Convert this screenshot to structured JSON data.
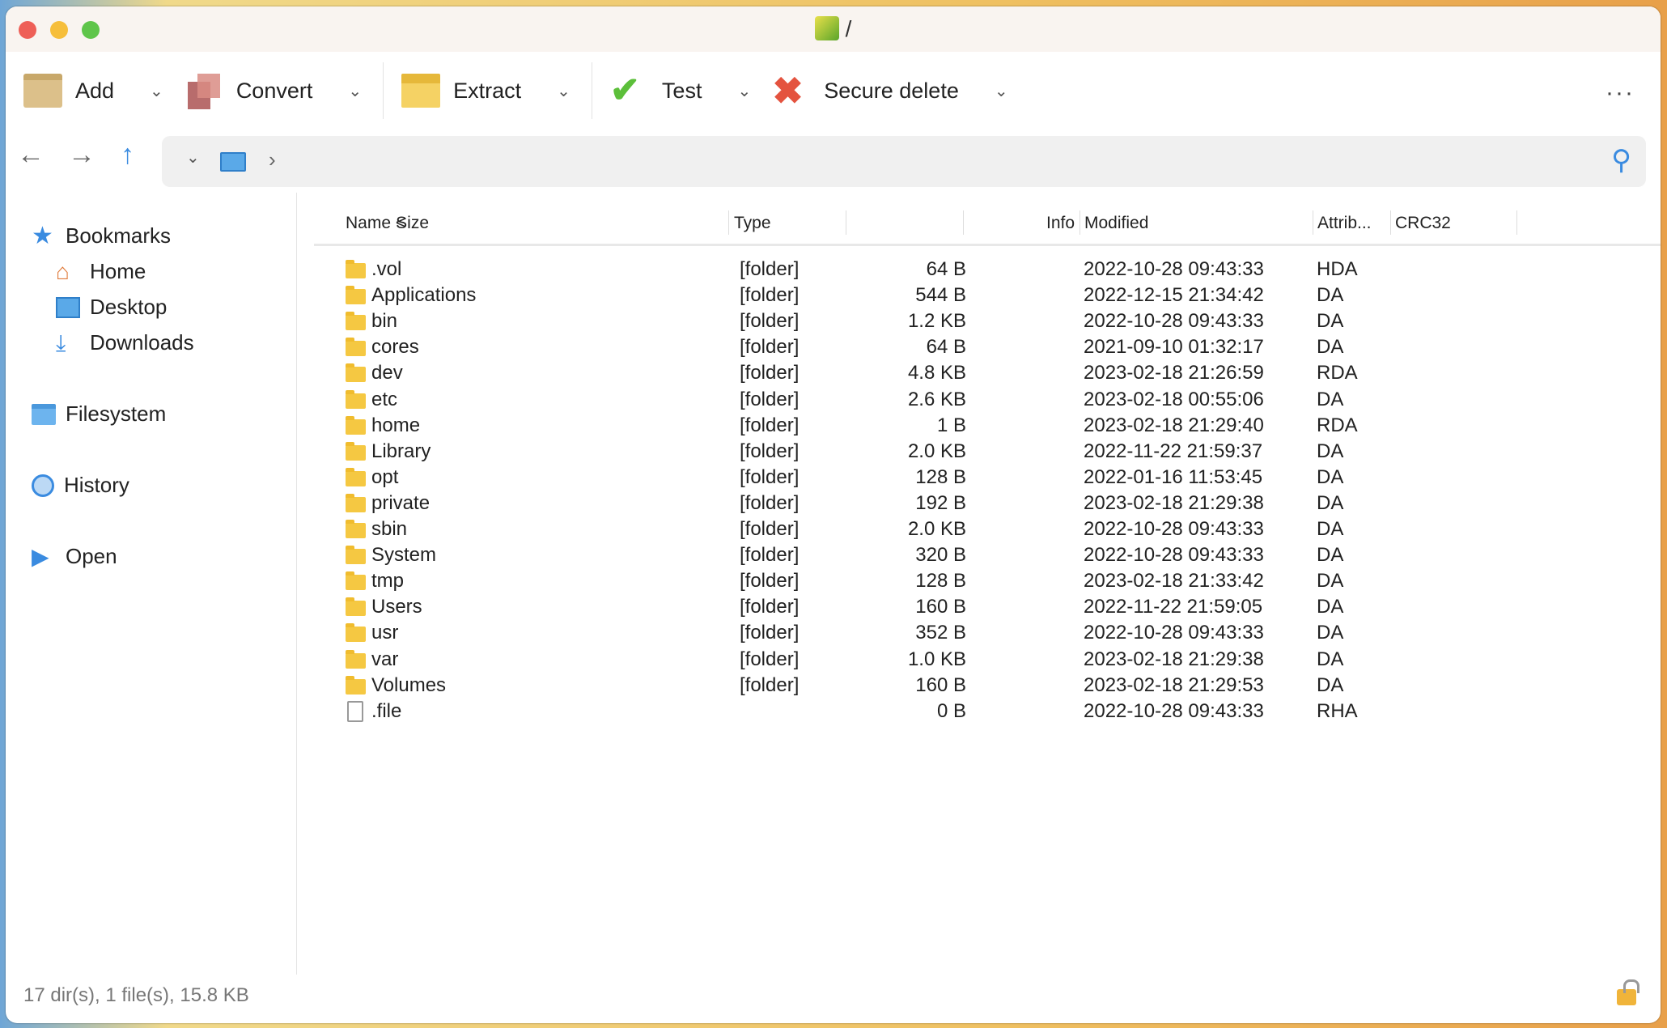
{
  "window": {
    "title": "/"
  },
  "toolbar": {
    "add": "Add",
    "convert": "Convert",
    "extract": "Extract",
    "test": "Test",
    "secure_delete": "Secure delete",
    "more": "···"
  },
  "sidebar": {
    "bookmarks": "Bookmarks",
    "home": "Home",
    "desktop": "Desktop",
    "downloads": "Downloads",
    "filesystem": "Filesystem",
    "history": "History",
    "open": "Open"
  },
  "columns": {
    "name": "Name <",
    "type": "Type",
    "size": "Size",
    "info": "Info",
    "modified": "Modified",
    "attrib": "Attrib...",
    "crc32": "CRC32"
  },
  "rows": [
    {
      "name": ".vol",
      "type": "[folder]",
      "size": "64 B",
      "modified": "2022-10-28 09:43:33",
      "attrib": "HDA",
      "kind": "folder"
    },
    {
      "name": "Applications",
      "type": "[folder]",
      "size": "544 B",
      "modified": "2022-12-15 21:34:42",
      "attrib": "DA",
      "kind": "folder"
    },
    {
      "name": "bin",
      "type": "[folder]",
      "size": "1.2 KB",
      "modified": "2022-10-28 09:43:33",
      "attrib": "DA",
      "kind": "folder"
    },
    {
      "name": "cores",
      "type": "[folder]",
      "size": "64 B",
      "modified": "2021-09-10 01:32:17",
      "attrib": "DA",
      "kind": "folder"
    },
    {
      "name": "dev",
      "type": "[folder]",
      "size": "4.8 KB",
      "modified": "2023-02-18 21:26:59",
      "attrib": "RDA",
      "kind": "folder"
    },
    {
      "name": "etc",
      "type": "[folder]",
      "size": "2.6 KB",
      "modified": "2023-02-18 00:55:06",
      "attrib": "DA",
      "kind": "folder"
    },
    {
      "name": "home",
      "type": "[folder]",
      "size": "1 B",
      "modified": "2023-02-18 21:29:40",
      "attrib": "RDA",
      "kind": "folder"
    },
    {
      "name": "Library",
      "type": "[folder]",
      "size": "2.0 KB",
      "modified": "2022-11-22 21:59:37",
      "attrib": "DA",
      "kind": "folder"
    },
    {
      "name": "opt",
      "type": "[folder]",
      "size": "128 B",
      "modified": "2022-01-16 11:53:45",
      "attrib": "DA",
      "kind": "folder"
    },
    {
      "name": "private",
      "type": "[folder]",
      "size": "192 B",
      "modified": "2023-02-18 21:29:38",
      "attrib": "DA",
      "kind": "folder"
    },
    {
      "name": "sbin",
      "type": "[folder]",
      "size": "2.0 KB",
      "modified": "2022-10-28 09:43:33",
      "attrib": "DA",
      "kind": "folder"
    },
    {
      "name": "System",
      "type": "[folder]",
      "size": "320 B",
      "modified": "2022-10-28 09:43:33",
      "attrib": "DA",
      "kind": "folder"
    },
    {
      "name": "tmp",
      "type": "[folder]",
      "size": "128 B",
      "modified": "2023-02-18 21:33:42",
      "attrib": "DA",
      "kind": "folder"
    },
    {
      "name": "Users",
      "type": "[folder]",
      "size": "160 B",
      "modified": "2022-11-22 21:59:05",
      "attrib": "DA",
      "kind": "folder"
    },
    {
      "name": "usr",
      "type": "[folder]",
      "size": "352 B",
      "modified": "2022-10-28 09:43:33",
      "attrib": "DA",
      "kind": "folder"
    },
    {
      "name": "var",
      "type": "[folder]",
      "size": "1.0 KB",
      "modified": "2023-02-18 21:29:38",
      "attrib": "DA",
      "kind": "folder"
    },
    {
      "name": "Volumes",
      "type": "[folder]",
      "size": "160 B",
      "modified": "2023-02-18 21:29:53",
      "attrib": "DA",
      "kind": "folder"
    },
    {
      "name": ".file",
      "type": "",
      "size": "0 B",
      "modified": "2022-10-28 09:43:33",
      "attrib": "RHA",
      "kind": "file"
    }
  ],
  "status": "17 dir(s), 1 file(s), 15.8 KB"
}
